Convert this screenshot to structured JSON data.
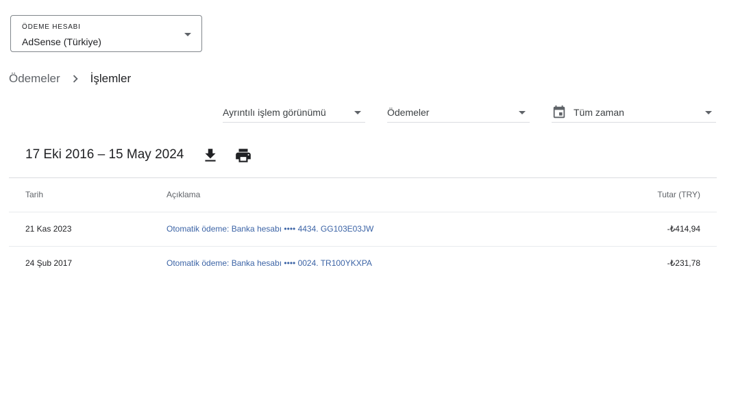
{
  "account": {
    "label": "ÖDEME HESABI",
    "value": "AdSense (Türkiye)"
  },
  "breadcrumb": {
    "parent": "Ödemeler",
    "current": "İşlemler"
  },
  "filters": {
    "view": "Ayrıntılı işlem görünümü",
    "type": "Ödemeler",
    "date": "Tüm zaman"
  },
  "range": {
    "title": "17 Eki 2016 – 15 May 2024"
  },
  "table": {
    "headers": {
      "date": "Tarih",
      "description": "Açıklama",
      "amount": "Tutar (TRY)"
    },
    "rows": [
      {
        "date": "21 Kas 2023",
        "description": "Otomatik ödeme: Banka hesabı •••• 4434. GG103E03JW",
        "amount": "-₺414,94"
      },
      {
        "date": "24 Şub 2017",
        "description": "Otomatik ödeme: Banka hesabı •••• 0024. TR100YKXPA",
        "amount": "-₺231,78"
      }
    ]
  },
  "icons": {
    "calendar": "calendar-icon",
    "download": "download-icon",
    "print": "print-icon",
    "chevron": "chevron-right-icon",
    "dropdown": "arrow-drop-down-icon"
  }
}
